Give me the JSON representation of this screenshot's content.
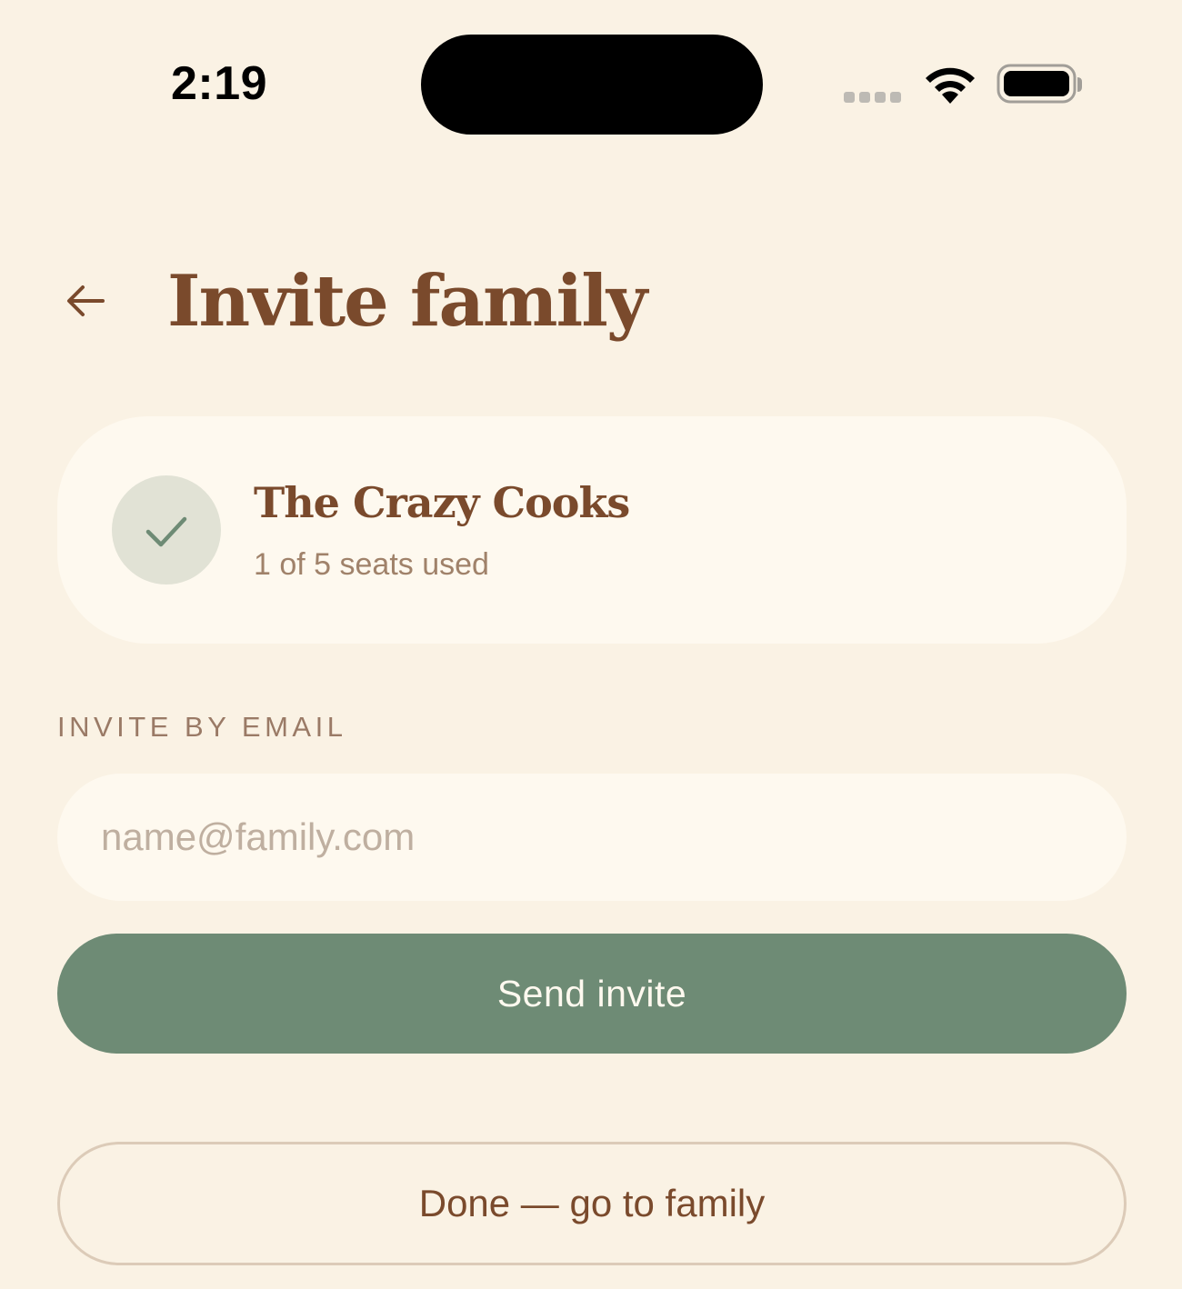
{
  "status_bar": {
    "time": "2:19"
  },
  "header": {
    "back_icon": "arrow-left-icon",
    "title": "Invite family"
  },
  "family_card": {
    "icon": "checkmark-icon",
    "name": "The Crazy Cooks",
    "seats": "1 of 5 seats used"
  },
  "invite_section": {
    "label": "INVITE BY EMAIL",
    "email_value": "",
    "email_placeholder": "name@family.com",
    "send_label": "Send invite"
  },
  "done_label": "Done — go to family",
  "colors": {
    "background": "#FAF2E4",
    "card": "#FEF9EF",
    "brown": "#7A4A2C",
    "sage": "#6E8B75",
    "muted": "#A0826A"
  }
}
